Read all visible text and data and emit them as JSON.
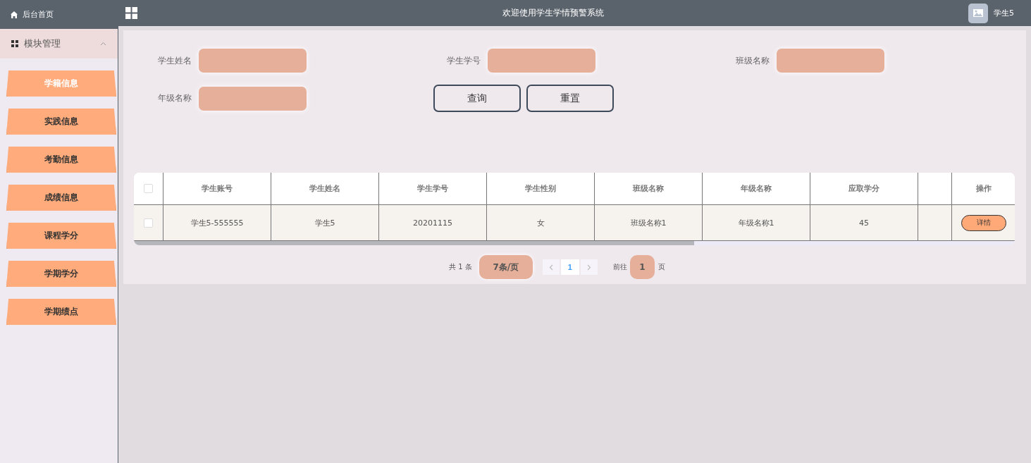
{
  "top_bar": {
    "title": "欢迎使用学生学情预警系统",
    "user_name": "学生5"
  },
  "sidebar": {
    "home": "后台首页",
    "group": {
      "label": "模块管理",
      "expanded": true
    },
    "items": [
      {
        "label": "学籍信息",
        "selected": true
      },
      {
        "label": "实践信息",
        "selected": false
      },
      {
        "label": "考勤信息",
        "selected": false
      },
      {
        "label": "成绩信息",
        "selected": false
      },
      {
        "label": "课程学分",
        "selected": false
      },
      {
        "label": "学期学分",
        "selected": false
      },
      {
        "label": "学期绩点",
        "selected": false
      }
    ]
  },
  "search": {
    "fields": [
      {
        "label": "学生姓名"
      },
      {
        "label": "学生学号"
      },
      {
        "label": "班级名称"
      },
      {
        "label": "年级名称"
      }
    ],
    "buttons": [
      {
        "label": "查询"
      },
      {
        "label": "重置"
      }
    ]
  },
  "table": {
    "columns": [
      "学生账号",
      "学生姓名",
      "学生学号",
      "学生性别",
      "班级名称",
      "年级名称",
      "应取学分"
    ],
    "action_column": "操作",
    "rows": [
      {
        "checked": false,
        "cells": [
          "学生5-555555",
          "学生5",
          "20201115",
          "女",
          "班级名称1",
          "年级名称1",
          "45"
        ],
        "action": "详情"
      }
    ],
    "all_checked": false
  },
  "pagination": {
    "total": "共 1 条",
    "page_size": "7条/页",
    "pages": [
      {
        "label": "1",
        "selected": true
      }
    ],
    "goto_label": "前往",
    "goto_value": "1",
    "goto_unit": "页"
  }
}
